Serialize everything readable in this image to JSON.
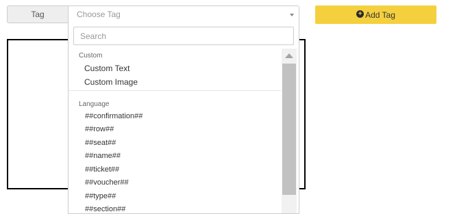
{
  "tag_field": {
    "addon_label": "Tag",
    "select_placeholder": "Choose Tag"
  },
  "add_button": {
    "label": "Add Tag",
    "icon": "plus-circle-icon",
    "color": "#f4d03f"
  },
  "dropdown": {
    "search_placeholder": "Search",
    "search_value": "",
    "groups": [
      {
        "label": "Custom",
        "options": [
          "Custom Text",
          "Custom Image"
        ]
      },
      {
        "label": "Language",
        "options": [
          "##confirmation##",
          "##row##",
          "##seat##",
          "##name##",
          "##ticket##",
          "##voucher##",
          "##type##",
          "##section##"
        ]
      }
    ]
  }
}
